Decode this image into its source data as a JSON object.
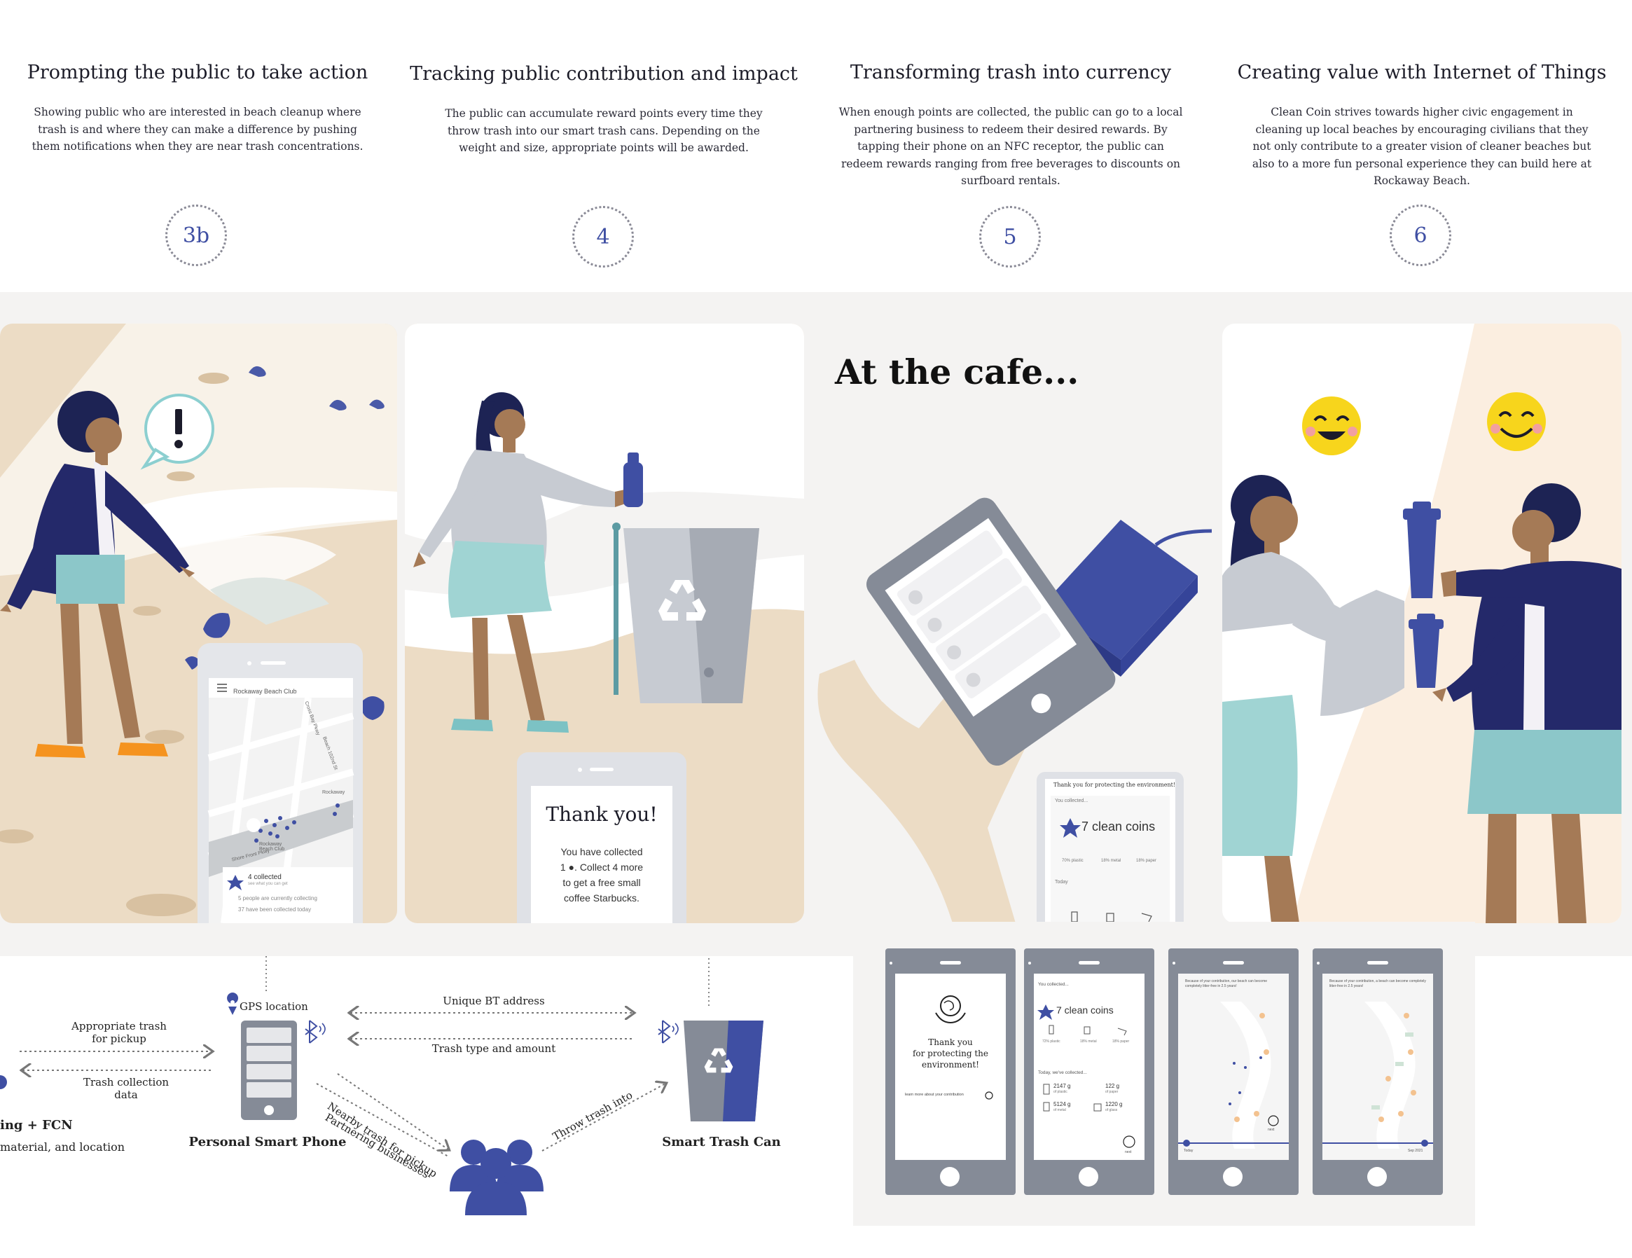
{
  "steps": [
    {
      "title": "Prompting the public to take action",
      "desc": "Showing public who are interested in beach cleanup where trash is and where they can make a difference by pushing them notifications when they are near trash concentrations.",
      "num": "3b"
    },
    {
      "title": "Tracking public contribution and impact",
      "desc": "The public can accumulate reward points every time they throw trash into our smart trash cans. Depending on the weight and size, appropriate points will be awarded.",
      "num": "4"
    },
    {
      "title": "Transforming trash into currency",
      "desc": "When enough points are collected, the public can go to a local partnering business to redeem their desired rewards. By tapping their phone on an NFC receptor, the public can redeem rewards ranging from free beverages to discounts on surfboard rentals.",
      "num": "5"
    },
    {
      "title": "Creating value with Internet of Things",
      "desc": "Clean Coin strives towards higher civic engagement in cleaning up local beaches by encouraging civilians that they not only contribute to a greater vision of cleaner beaches but also to a more fun personal experience they can build here at Rockaway Beach.",
      "num": "6"
    }
  ],
  "panel1": {
    "map_title": "Rockaway Beach Club",
    "streets": [
      "Beach 102nd St",
      "Cross Bay Pkwy",
      "Shore Front Pkwy",
      "Rockaway Beach Club",
      "Rockaway"
    ],
    "collected": "4 collected",
    "collected_sub": "see what you can get",
    "people": "5  people are currently collecting",
    "today": "37  have been collected today"
  },
  "panel2": {
    "thank_title": "Thank you!",
    "thank_lines": [
      "You have collected",
      "1 ●. Collect 4 more",
      "to get a free small",
      "coffee Starbucks."
    ]
  },
  "panel3": {
    "heading": "At the cafe...",
    "phone_header": "Thank you for protecting the environment!",
    "you_collected": "You collected...",
    "coins": "7 clean coins",
    "stats": [
      "70% plastic",
      "18% metal",
      "18% paper"
    ],
    "today": "Today"
  },
  "diagram": {
    "gps": "GPS location",
    "unique_bt": "Unique BT address",
    "trash_type": "Trash type and amount",
    "appropriate": "Appropriate trash\nfor pickup",
    "collection": "Trash collection\ndata",
    "left_title": "ing + FCN",
    "left_sub": "material, and location",
    "phone_label": "Personal Smart Phone",
    "can_label": "Smart Trash Can",
    "nearby": "Nearby trash for pickup",
    "partnering": "Partnering businesses",
    "throw": "Throw trash into"
  },
  "mockups": [
    {
      "title": "Thank you\nfor protecting the\nenvironment!",
      "link": "learn more about your contribution"
    },
    {
      "you_collected": "You collected...",
      "coins": "7 clean coins",
      "stats": [
        "72% plastic",
        "18% metal",
        "18% paper"
      ],
      "today": "Today, we've collected...",
      "amounts": [
        [
          "2147 g",
          "of plastic"
        ],
        [
          "122 g",
          "of paper"
        ],
        [
          "5124 g",
          "of metal"
        ],
        [
          "1220 g",
          "of glass"
        ]
      ],
      "next": "next"
    },
    {
      "caption": "Because of your contribution, our beach can become completely litter-free in 2.5 years!",
      "left": "Today",
      "next": "next"
    },
    {
      "caption": "Because of your contribution, a beach can become completely litter-free in 2.5 years!",
      "right": "Sep 2021"
    }
  ],
  "colors": {
    "navy": "#3f4fa3",
    "sand": "#ecdcc5",
    "band": "#f4f3f2",
    "grey": "#858b97",
    "teal": "#9fd0cf"
  }
}
